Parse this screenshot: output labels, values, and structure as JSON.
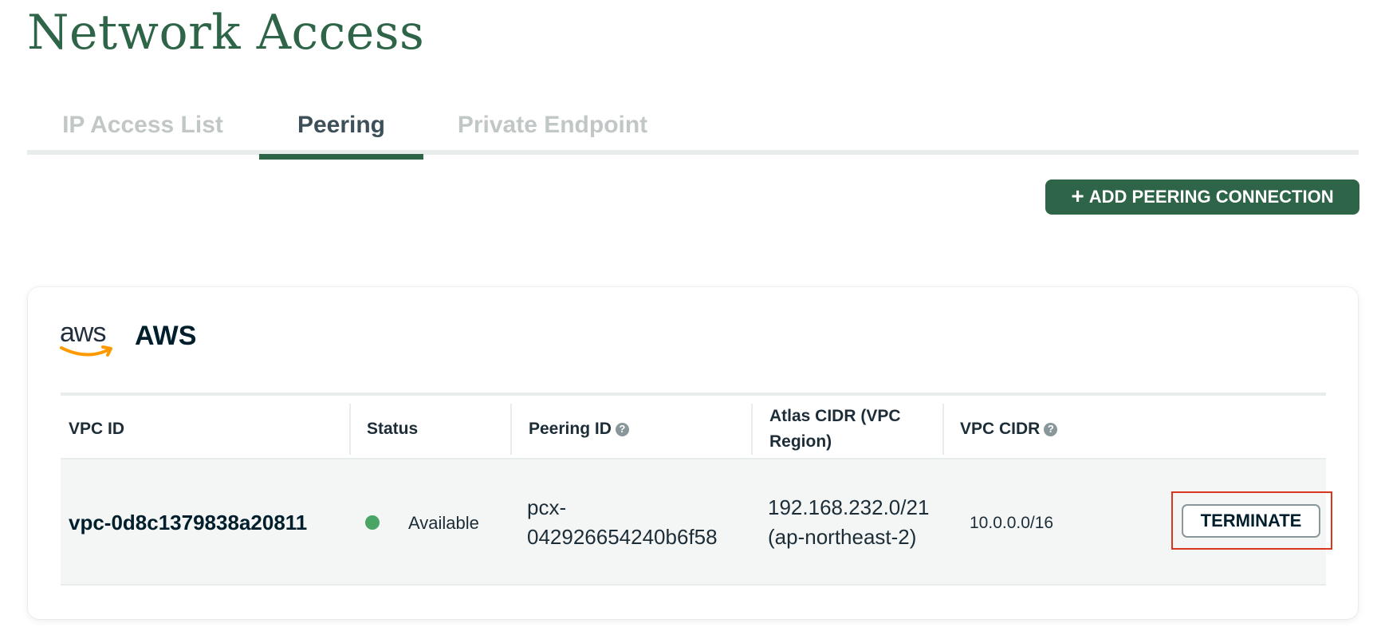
{
  "page": {
    "title": "Network Access"
  },
  "tabs": [
    {
      "label": "IP Access List",
      "active": false
    },
    {
      "label": "Peering",
      "active": true
    },
    {
      "label": "Private Endpoint",
      "active": false
    }
  ],
  "actions": {
    "add_peering_label": "ADD PEERING CONNECTION"
  },
  "provider": {
    "logo_text": "aws",
    "name": "AWS"
  },
  "table": {
    "columns": [
      {
        "label": "VPC ID",
        "help": false
      },
      {
        "label": "Status",
        "help": false
      },
      {
        "label": "Peering ID",
        "help": true
      },
      {
        "label": "Atlas CIDR (VPC Region)",
        "help": false
      },
      {
        "label": "VPC CIDR",
        "help": true
      }
    ],
    "rows": [
      {
        "vpc_id": "vpc-0d8c1379838a20811",
        "status": "Available",
        "peering_id": "pcx-042926654240b6f58",
        "atlas_cidr": "192.168.232.0/21 (ap-northeast-2)",
        "vpc_cidr": "10.0.0.0/16",
        "action_label": "TERMINATE"
      }
    ]
  },
  "colors": {
    "brand_green": "#2e6447",
    "status_available": "#4aa564",
    "highlight_red": "#d9361e",
    "aws_orange": "#ff9900"
  },
  "icons": {
    "help": "question-circle-icon",
    "plus": "plus-icon",
    "status": "status-dot-icon",
    "logo": "aws-logo-icon"
  }
}
